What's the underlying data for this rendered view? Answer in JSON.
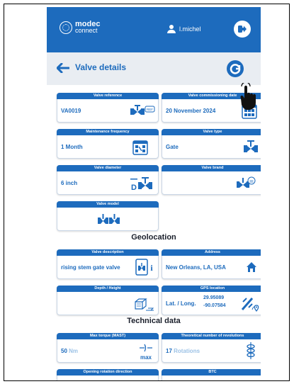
{
  "app": {
    "logo_line1": "modec",
    "logo_line2": "connect",
    "username": "l.michel"
  },
  "header": {
    "title": "Valve details"
  },
  "cards": {
    "valve_reference": {
      "label": "Valve reference",
      "value": "VA0019",
      "badge": "REF"
    },
    "commissioning": {
      "label": "Valve commissioning date",
      "value": "20 November 2024"
    },
    "maintenance": {
      "label": "Maintenance frequency",
      "value": "1 Month"
    },
    "valve_type": {
      "label": "Valve type",
      "value": "Gate"
    },
    "diameter": {
      "label": "Valve diameter",
      "value": "6 inch",
      "badge": "D"
    },
    "brand": {
      "label": "Valve brand",
      "value": ""
    },
    "model": {
      "label": "Valve model",
      "value": ""
    },
    "description": {
      "label": "Valve description",
      "value": "rising stem gate valve"
    },
    "address": {
      "label": "Address",
      "value": "New Orleans, LA, USA"
    },
    "depth": {
      "label": "Depth / Height",
      "value": ""
    },
    "gps": {
      "label": "GPS location",
      "prefix": "Lat. / Long.",
      "lat": "29.95089",
      "long": "-90.07584"
    },
    "max_torque": {
      "label": "Max torque (MAST)",
      "value": "50",
      "unit": "Nm",
      "badge": "max"
    },
    "revolutions": {
      "label": "Theoretical number of revolutions",
      "value": "17",
      "unit": "Rotations"
    },
    "opening_direction": {
      "label": "Opening rotation direction"
    },
    "btc": {
      "label": "BTC"
    }
  },
  "sections": {
    "geolocation": "Geolocation",
    "technical": "Technical data"
  },
  "colors": {
    "primary": "#1d6bbd",
    "header_bg": "#e9edf2",
    "faded": "#9cc2e6"
  }
}
